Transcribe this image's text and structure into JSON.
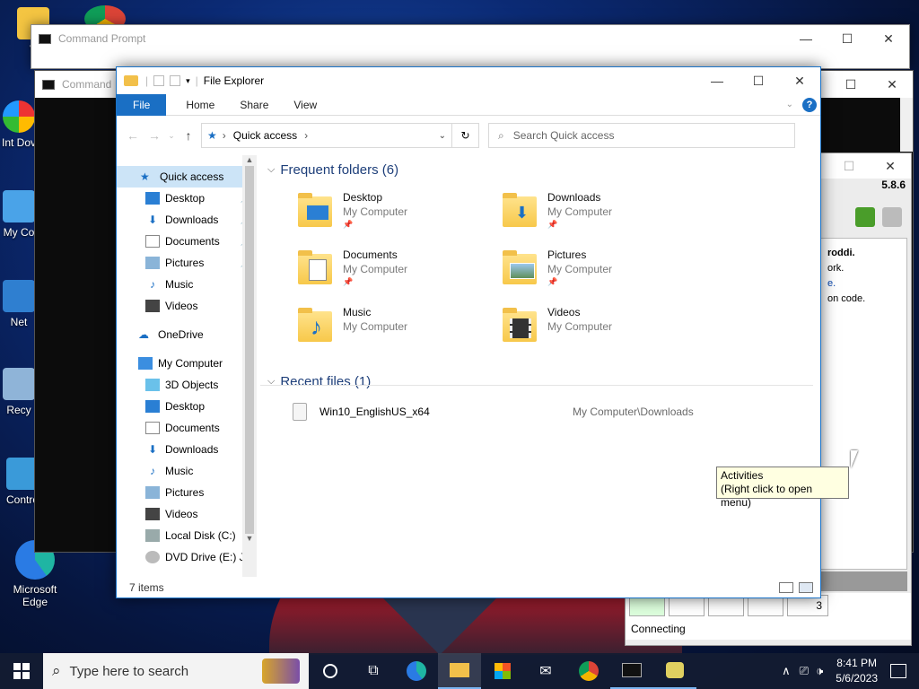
{
  "desktop": {
    "icons": [
      {
        "label": "V"
      },
      {
        "label": "Int Dov"
      },
      {
        "label": "My Co"
      },
      {
        "label": "Net"
      },
      {
        "label": "Recy"
      },
      {
        "label": "Contro"
      },
      {
        "label": "Microsoft Edge"
      }
    ]
  },
  "cmd_window_1": {
    "title": "Command Prompt"
  },
  "cmd_window_2": {
    "title": "Command"
  },
  "right_app": {
    "version": "5.8.6",
    "lines": [
      "roddi.",
      "ork.",
      "e.",
      "on code."
    ],
    "status": "Connecting",
    "badge_count": "3"
  },
  "explorer": {
    "title": "File Explorer",
    "tabs": [
      "File",
      "Home",
      "Share",
      "View"
    ],
    "address": "Quick access",
    "search_placeholder": "Search Quick access",
    "nav": {
      "quick_access": "Quick access",
      "qa_items": [
        "Desktop",
        "Downloads",
        "Documents",
        "Pictures",
        "Music",
        "Videos"
      ],
      "onedrive": "OneDrive",
      "my_computer": "My Computer",
      "pc_items": [
        "3D Objects",
        "Desktop",
        "Documents",
        "Downloads",
        "Music",
        "Pictures",
        "Videos",
        "Local Disk (C:)",
        "DVD Drive (E:) J_"
      ]
    },
    "frequent_header": "Frequent folders (6)",
    "folders": [
      {
        "name": "Desktop",
        "location": "My Computer",
        "pinned": true
      },
      {
        "name": "Downloads",
        "location": "My Computer",
        "pinned": true
      },
      {
        "name": "Documents",
        "location": "My Computer",
        "pinned": true
      },
      {
        "name": "Pictures",
        "location": "My Computer",
        "pinned": true
      },
      {
        "name": "Music",
        "location": "My Computer",
        "pinned": false
      },
      {
        "name": "Videos",
        "location": "My Computer",
        "pinned": false
      }
    ],
    "recent_header": "Recent files (1)",
    "recent_files": [
      {
        "name": "Win10_EnglishUS_x64",
        "path": "My Computer\\Downloads"
      }
    ],
    "status": "7 items"
  },
  "tooltip": {
    "line1": "Activities",
    "line2": "(Right click to open menu)"
  },
  "taskbar": {
    "search_placeholder": "Type here to search",
    "time": "8:41 PM",
    "date": "5/6/2023"
  }
}
